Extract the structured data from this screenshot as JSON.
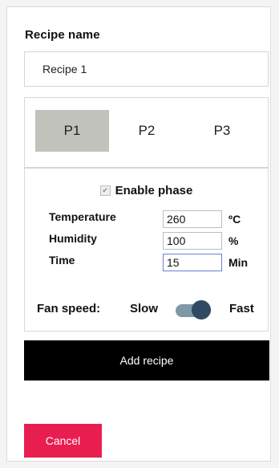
{
  "recipe": {
    "label": "Recipe name",
    "name_value": "Recipe 1"
  },
  "phases": {
    "tabs": [
      "P1",
      "P2",
      "P3"
    ],
    "active_tab": "P1",
    "enable_label": "Enable phase",
    "enable_checked": true,
    "params": [
      {
        "label": "Temperature",
        "value": "260",
        "unit": "ºC"
      },
      {
        "label": "Humidity",
        "value": "100",
        "unit": "%"
      },
      {
        "label": "Time",
        "value": "15",
        "unit": "Min"
      }
    ],
    "fan": {
      "label": "Fan speed:",
      "low_label": "Slow",
      "high_label": "Fast",
      "state": "Fast"
    }
  },
  "actions": {
    "add_label": "Add recipe",
    "cancel_label": "Cancel"
  },
  "colors": {
    "active_tab": "#c2c2bc",
    "add_button": "#000000",
    "cancel_button": "#e91e50",
    "toggle_track": "#7f97a6",
    "toggle_knob": "#2f4a62"
  }
}
